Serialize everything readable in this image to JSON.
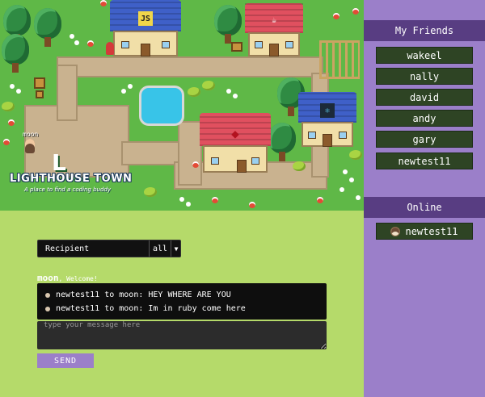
{
  "map": {
    "logo_title": "LIGHTHOUSE TOWN",
    "logo_tagline": "A place to find a coding buddy",
    "player_name": "moon",
    "buildings": [
      {
        "name": "js-house",
        "emblem": "JS",
        "roof": "#3f60c8"
      },
      {
        "name": "coffee-house",
        "emblem": "☕",
        "roof": "#e0505f"
      },
      {
        "name": "ruby-house",
        "emblem": "◆",
        "roof": "#e0505f"
      },
      {
        "name": "react-house",
        "emblem": "⚛",
        "roof": "#3f60c8"
      }
    ]
  },
  "sidebar": {
    "friends_heading": "My Friends",
    "friends": [
      "wakeel",
      "nally",
      "david",
      "andy",
      "gary",
      "newtest11"
    ],
    "online_heading": "Online",
    "online": [
      "newtest11"
    ]
  },
  "chat": {
    "recipient_label": "Recipient",
    "recipient_value": "all",
    "greeting_name": "moon",
    "greeting_text": ", Welcome!",
    "messages": [
      "newtest11 to moon: HEY WHERE ARE YOU",
      "newtest11 to moon: Im in ruby come here"
    ],
    "input_placeholder": "type your message here",
    "send_label": "SEND"
  },
  "colors": {
    "page_bg": "#b5da6a",
    "sidebar_bg": "#9b7fc9",
    "sidebar_header": "#583d82",
    "friend_button": "#2e4424",
    "send_button": "#9b7fc9"
  }
}
